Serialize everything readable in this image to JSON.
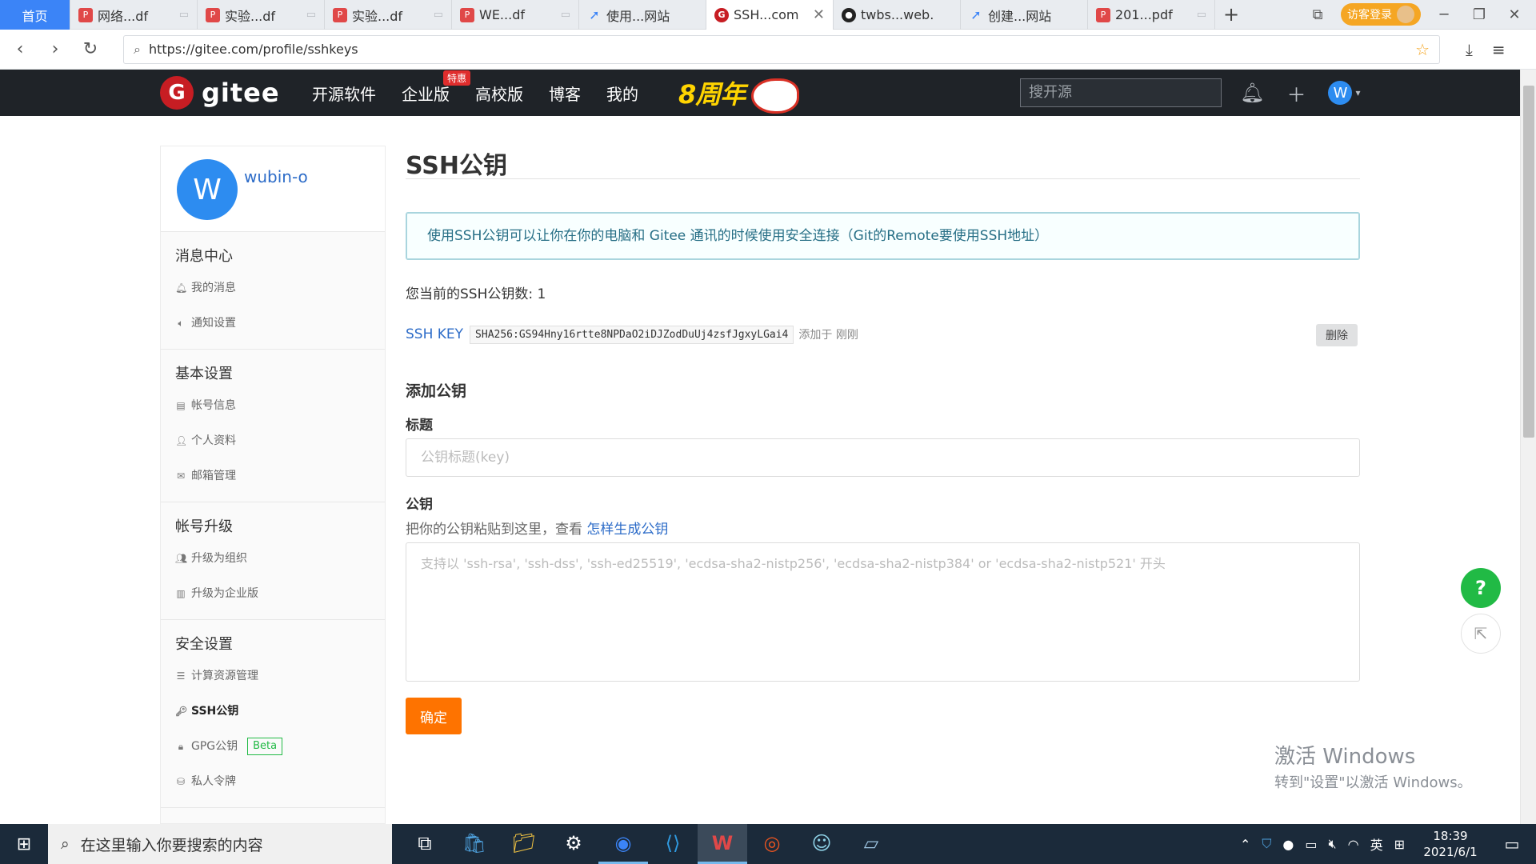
{
  "browser": {
    "tabs": [
      {
        "label": "首页",
        "icon": "home",
        "kind": "home"
      },
      {
        "label": "网络...df",
        "icon": "pdf-icon",
        "kind": "pdf"
      },
      {
        "label": "实验...df",
        "icon": "pdf-icon",
        "kind": "pdf"
      },
      {
        "label": "实验...df",
        "icon": "pdf-icon",
        "kind": "pdf"
      },
      {
        "label": "WE...df",
        "icon": "pdf-icon",
        "kind": "pdf"
      },
      {
        "label": "使用...网站",
        "icon": "rocket-icon",
        "kind": "rocket"
      },
      {
        "label": "SSH...com",
        "icon": "gitee-icon",
        "kind": "gitee",
        "active": true
      },
      {
        "label": "twbs...web.",
        "icon": "github-icon",
        "kind": "gh"
      },
      {
        "label": "创建...网站",
        "icon": "rocket-icon",
        "kind": "rocket"
      },
      {
        "label": "201...pdf",
        "icon": "pdf-icon",
        "kind": "pdf"
      }
    ],
    "visitor_login": "访客登录",
    "url": "https://gitee.com/profile/sshkeys"
  },
  "gitee": {
    "logo_text": "gitee",
    "nav": [
      "开源软件",
      "企业版",
      "高校版",
      "博客",
      "我的"
    ],
    "nav_badge": "特惠",
    "anniversary": "8周年",
    "search_placeholder": "搜开源",
    "user_initial": "W"
  },
  "sidebar": {
    "avatar_initial": "W",
    "username": "wubin-o",
    "groups": [
      {
        "title": "消息中心",
        "items": [
          {
            "label": "我的消息",
            "icon": "bell-icon"
          },
          {
            "label": "通知设置",
            "icon": "speaker-icon"
          }
        ]
      },
      {
        "title": "基本设置",
        "items": [
          {
            "label": "帐号信息",
            "icon": "id-card-icon"
          },
          {
            "label": "个人资料",
            "icon": "user-icon"
          },
          {
            "label": "邮箱管理",
            "icon": "mail-icon"
          }
        ]
      },
      {
        "title": "帐号升级",
        "items": [
          {
            "label": "升级为组织",
            "icon": "users-icon"
          },
          {
            "label": "升级为企业版",
            "icon": "building-icon"
          }
        ]
      },
      {
        "title": "安全设置",
        "items": [
          {
            "label": "计算资源管理",
            "icon": "server-icon"
          },
          {
            "label": "SSH公钥",
            "icon": "key-icon",
            "active": true
          },
          {
            "label": "GPG公钥",
            "icon": "lock-icon",
            "badge": "Beta"
          },
          {
            "label": "私人令牌",
            "icon": "token-icon"
          }
        ]
      }
    ]
  },
  "main": {
    "title": "SSH公钥",
    "info": "使用SSH公钥可以让你在你的电脑和 Gitee 通讯的时候使用安全连接（Git的Remote要使用SSH地址）",
    "count_text": "您当前的SSH公钥数: 1",
    "key": {
      "label": "SSH KEY",
      "fingerprint": "SHA256:GS94Hny16rtte8NPDaO2iDJZodDuUj4zsfJgxyLGai4",
      "added": "添加于 刚刚",
      "delete": "删除"
    },
    "add_title": "添加公钥",
    "field_title_label": "标题",
    "field_title_placeholder": "公钥标题(key)",
    "field_key_label": "公钥",
    "field_key_hint": "把你的公钥粘贴到这里，查看",
    "field_key_hint_link": "怎样生成公钥",
    "field_key_placeholder": "支持以 'ssh-rsa', 'ssh-dss', 'ssh-ed25519', 'ecdsa-sha2-nistp256', 'ecdsa-sha2-nistp384' or 'ecdsa-sha2-nistp521' 开头",
    "submit": "确定"
  },
  "floating": {
    "help": "?"
  },
  "watermark": {
    "line1": "激活 Windows",
    "line2": "转到\"设置\"以激活 Windows。"
  },
  "taskbar": {
    "search_placeholder": "在这里输入你要搜索的内容",
    "ime_lang": "英",
    "time": "18:39",
    "date": "2021/6/1"
  }
}
